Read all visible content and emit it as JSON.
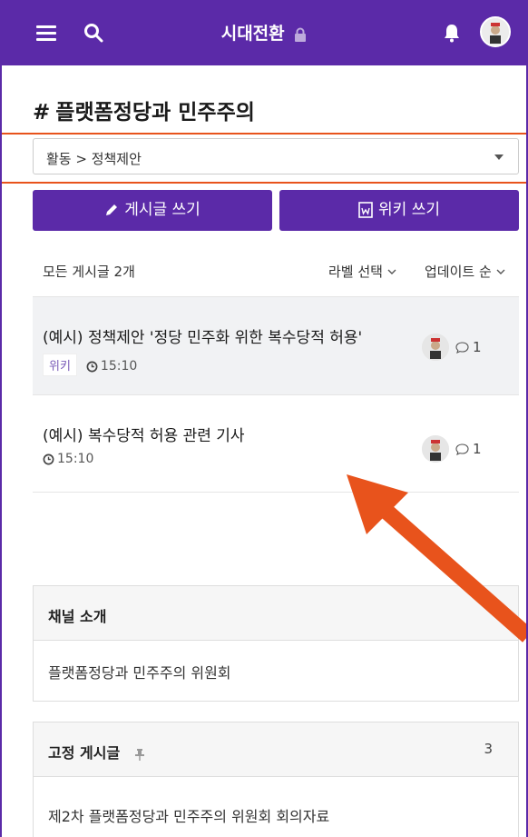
{
  "header": {
    "title": "시대전환",
    "colors": {
      "accent": "#5b2aa8",
      "highlight": "#e8531c"
    }
  },
  "page": {
    "hash": "#",
    "title": "플랫폼정당과 민주주의"
  },
  "category_select": {
    "value": "활동 > 정책제안"
  },
  "actions": {
    "write_post": "게시글 쓰기",
    "write_wiki": "위키 쓰기"
  },
  "list_header": {
    "count": "모든 게시글 2개",
    "label_select": "라벨 선택",
    "sort": "업데이트 순"
  },
  "posts": [
    {
      "title": "(예시) 정책제안 '정당 민주화 위한 복수당적 허용'",
      "tag": "위키",
      "time": "15:10",
      "comments": "1"
    },
    {
      "title": "(예시) 복수당적 허용 관련 기사",
      "tag": "",
      "time": "15:10",
      "comments": "1"
    }
  ],
  "channel_intro": {
    "title": "채널 소개",
    "body": "플랫폼정당과 민주주의 위원회"
  },
  "pinned": {
    "title": "고정 게시글",
    "count": "3",
    "first_item": "제2차 플랫폼정당과 민주주의 위원회 회의자료"
  }
}
